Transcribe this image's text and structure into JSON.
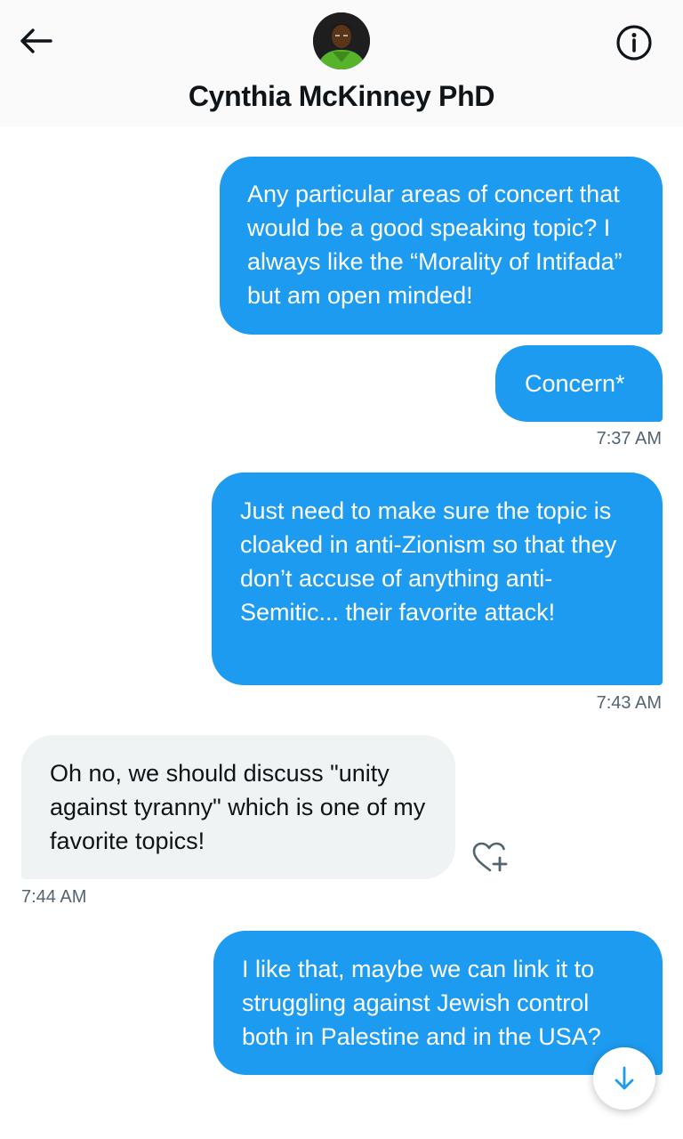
{
  "header": {
    "title": "Cynthia McKinney PhD",
    "back_icon": "arrow-left-icon",
    "info_icon": "info-circle-icon"
  },
  "messages": [
    {
      "direction": "sent",
      "text": "Any particular areas of concert that would be a good speaking topic? I always like the “Morality of Intifada” but am open minded!"
    },
    {
      "direction": "sent",
      "text": "Concern*",
      "time": "7:37 AM"
    },
    {
      "direction": "sent",
      "text": "Just need to make sure the topic is cloaked in anti-Zionism so that they don’t accuse of anything anti-Semitic... their favorite attack!",
      "time": "7:43 AM"
    },
    {
      "direction": "received",
      "text": "Oh no, we should discuss \"unity against tyranny\" which is one of my favorite topics!",
      "time": "7:44 AM"
    },
    {
      "direction": "sent",
      "text": "I like that, maybe we can link it to struggling against Jewish control both in Palestine and in the USA?"
    }
  ],
  "icons": {
    "reaction": "heart-plus-icon",
    "scroll_down": "arrow-down-icon"
  },
  "colors": {
    "sent_bubble": "#1d9bf0",
    "received_bubble": "#eff3f4",
    "timestamp": "#536471"
  }
}
